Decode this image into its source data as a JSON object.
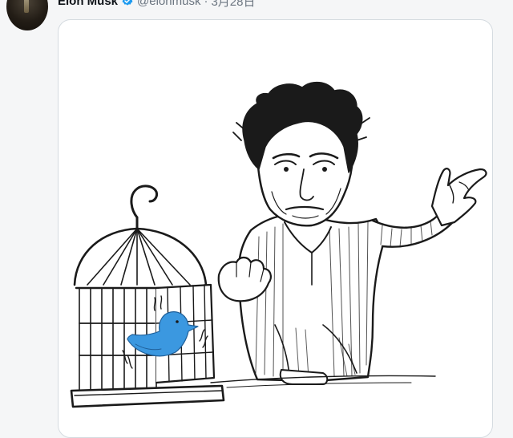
{
  "tweet": {
    "author_name": "Elon Musk",
    "handle": "@elonmusk",
    "separator": "·",
    "timestamp": "3月28日"
  },
  "colors": {
    "verified": "#1d9bf0",
    "bird": "#3b98e0",
    "ink": "#1a1a1a"
  },
  "icons": {
    "verified": "verified-badge-icon",
    "bird": "twitter-bird-icon"
  }
}
